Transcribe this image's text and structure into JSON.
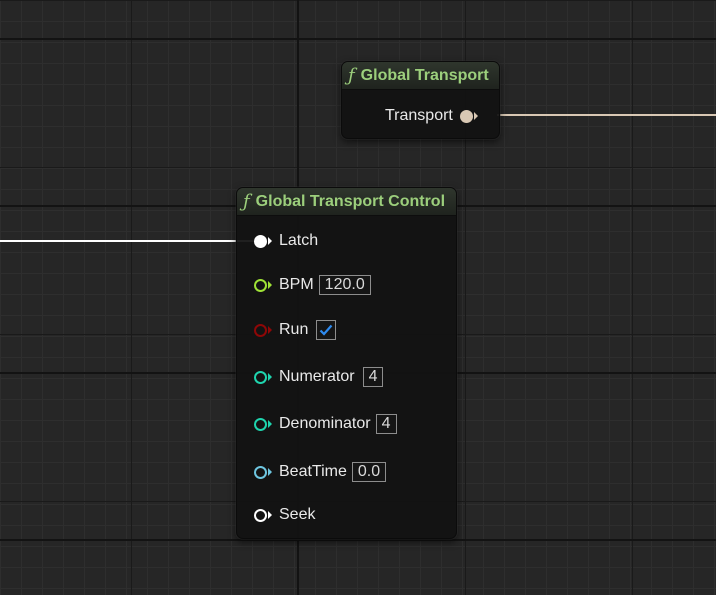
{
  "colors": {
    "exec": "#ffffff",
    "float": "#9fe236",
    "bool": "#8e0707",
    "int": "#1fd4ae",
    "time": "#6ec6e0",
    "transport": "#d9c8b4",
    "title": "#9ccf7c"
  },
  "icons": {
    "function": "function-icon",
    "check": "check-icon"
  },
  "global_transport": {
    "fn_glyph": "ƒ",
    "title": "Global Transport",
    "output": {
      "label": "Transport"
    }
  },
  "global_transport_control": {
    "fn_glyph": "ƒ",
    "title": "Global Transport Control",
    "pins": {
      "latch": {
        "label": "Latch"
      },
      "bpm": {
        "label": "BPM",
        "value": "120.0"
      },
      "run": {
        "label": "Run",
        "checked": true
      },
      "numerator": {
        "label": "Numerator",
        "value": "4"
      },
      "denominator": {
        "label": "Denominator",
        "value": "4"
      },
      "beattime": {
        "label": "BeatTime",
        "value": "0.0"
      },
      "seek": {
        "label": "Seek"
      }
    }
  }
}
